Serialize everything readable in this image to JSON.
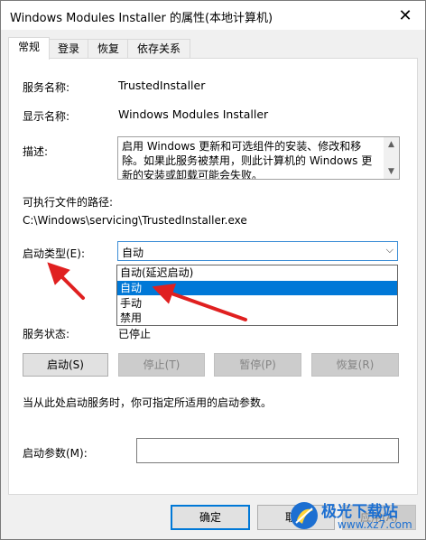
{
  "window": {
    "title": "Windows Modules Installer 的属性(本地计算机)"
  },
  "tabs": [
    "常规",
    "登录",
    "恢复",
    "依存关系"
  ],
  "general": {
    "service_name_label": "服务名称:",
    "service_name": "TrustedInstaller",
    "display_name_label": "显示名称:",
    "display_name": "Windows Modules Installer",
    "description_label": "描述:",
    "description": "启用 Windows 更新和可选组件的安装、修改和移除。如果此服务被禁用，则此计算机的 Windows 更新的安装或卸载可能会失败。",
    "path_label": "可执行文件的路径:",
    "path": "C:\\Windows\\servicing\\TrustedInstaller.exe",
    "startup_type_label": "启动类型(E):",
    "startup_type_value": "自动",
    "startup_options": [
      "自动(延迟启动)",
      "自动",
      "手动",
      "禁用"
    ],
    "startup_selected_index": 1,
    "service_status_label": "服务状态:",
    "service_status": "已停止",
    "buttons": {
      "start": "启动(S)",
      "stop": "停止(T)",
      "pause": "暂停(P)",
      "resume": "恢复(R)"
    },
    "hint": "当从此处启动服务时，你可指定所适用的启动参数。",
    "start_params_label": "启动参数(M):",
    "start_params_value": ""
  },
  "footer": {
    "ok": "确定",
    "cancel": "取消",
    "apply": "应用(A)"
  },
  "watermark": {
    "line1": "极光下载站",
    "line2": "www.xz7.com"
  },
  "colors": {
    "accent": "#0078d7",
    "annotation_arrow": "#e02020"
  },
  "icons": [
    "close-icon",
    "chevron-down-icon",
    "scroll-up-icon",
    "scroll-down-icon",
    "annotation-arrow-icon"
  ]
}
